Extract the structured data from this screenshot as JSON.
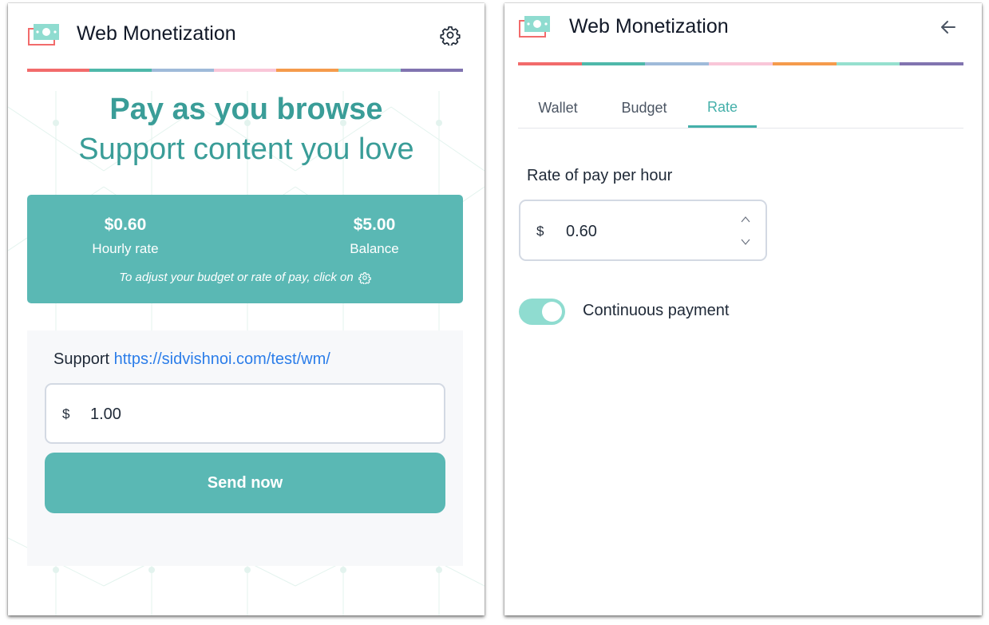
{
  "colors": {
    "brand_teal": "#5ab8b4",
    "hero_teal": "#3a9d98",
    "tab_active": "#45b0aa",
    "link_blue": "#2b7de9",
    "toggle_on": "#8fdcd0",
    "stripe": [
      "#f26b6b",
      "#4fb8aa",
      "#9fbad9",
      "#f9c6d8",
      "#f59b4c",
      "#96e0cf",
      "#8174b0"
    ]
  },
  "main_view": {
    "header": {
      "title": "Web Monetization",
      "settings_icon": "gear-icon",
      "logo_icon": "money-logo-icon"
    },
    "hero": {
      "title": "Pay as you browse",
      "subtitle": "Support content you love"
    },
    "stats": {
      "hourly_rate_value": "$0.60",
      "hourly_rate_label": "Hourly rate",
      "balance_value": "$5.00",
      "balance_label": "Balance",
      "hint": "To adjust your budget or rate of pay, click on",
      "hint_icon": "gear-icon"
    },
    "support": {
      "prefix": "Support",
      "url": "https://sidvishnoi.com/test/wm/",
      "currency": "$",
      "amount": "1.00",
      "send_label": "Send now"
    }
  },
  "settings_view": {
    "header": {
      "title": "Web Monetization",
      "back_icon": "arrow-left-icon",
      "logo_icon": "money-logo-icon"
    },
    "tabs": [
      {
        "label": "Wallet",
        "active": false
      },
      {
        "label": "Budget",
        "active": false
      },
      {
        "label": "Rate",
        "active": true
      }
    ],
    "rate": {
      "label": "Rate of pay per hour",
      "currency": "$",
      "value": "0.60"
    },
    "continuous_payment": {
      "label": "Continuous payment",
      "enabled": true
    }
  }
}
